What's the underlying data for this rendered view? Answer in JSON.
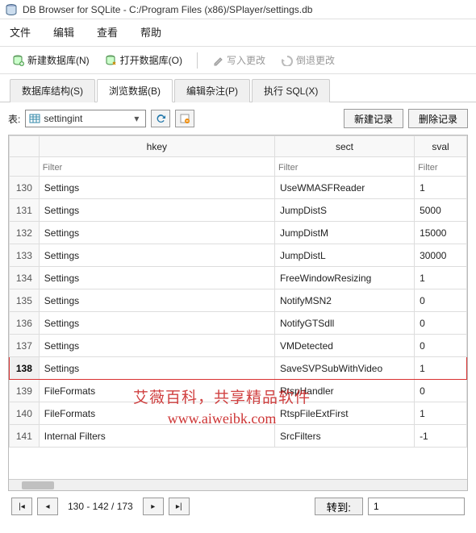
{
  "window": {
    "title": "DB Browser for SQLite - C:/Program Files (x86)/SPlayer/settings.db"
  },
  "menubar": {
    "file": "文件",
    "edit": "编辑",
    "view": "查看",
    "help": "帮助"
  },
  "toolbar": {
    "new_db": "新建数据库(N)",
    "open_db": "打开数据库(O)",
    "write_changes": "写入更改",
    "revert_changes": "倒退更改"
  },
  "tabs": {
    "structure": "数据库结构(S)",
    "browse": "浏览数据(B)",
    "pragmas": "编辑杂注(P)",
    "sql": "执行 SQL(X)"
  },
  "browse": {
    "table_label": "表:",
    "table_name": "settingint",
    "new_record": "新建记录",
    "delete_record": "删除记录",
    "columns": {
      "hkey": "hkey",
      "sect": "sect",
      "sval": "sval"
    },
    "filter_placeholder": "Filter",
    "rows": [
      {
        "rownum": "130",
        "hkey": "Settings",
        "sect": "UseWMASFReader",
        "sval": "1"
      },
      {
        "rownum": "131",
        "hkey": "Settings",
        "sect": "JumpDistS",
        "sval": "5000"
      },
      {
        "rownum": "132",
        "hkey": "Settings",
        "sect": "JumpDistM",
        "sval": "15000"
      },
      {
        "rownum": "133",
        "hkey": "Settings",
        "sect": "JumpDistL",
        "sval": "30000"
      },
      {
        "rownum": "134",
        "hkey": "Settings",
        "sect": "FreeWindowResizing",
        "sval": "1"
      },
      {
        "rownum": "135",
        "hkey": "Settings",
        "sect": "NotifyMSN2",
        "sval": "0"
      },
      {
        "rownum": "136",
        "hkey": "Settings",
        "sect": "NotifyGTSdll",
        "sval": "0"
      },
      {
        "rownum": "137",
        "hkey": "Settings",
        "sect": "VMDetected",
        "sval": "0"
      },
      {
        "rownum": "138",
        "hkey": "Settings",
        "sect": "SaveSVPSubWithVideo",
        "sval": "1",
        "highlight": true
      },
      {
        "rownum": "139",
        "hkey": "FileFormats",
        "sect": "RtspHandler",
        "sval": "0"
      },
      {
        "rownum": "140",
        "hkey": "FileFormats",
        "sect": "RtspFileExtFirst",
        "sval": "1"
      },
      {
        "rownum": "141",
        "hkey": "Internal Filters",
        "sect": "SrcFilters",
        "sval": "-1"
      }
    ]
  },
  "pager": {
    "range": "130 - 142 / 173",
    "goto_label": "转到:",
    "goto_value": "1"
  },
  "watermark": {
    "line1": "艾薇百科，共享精品软件",
    "line2": "www.aiweibk.com"
  }
}
